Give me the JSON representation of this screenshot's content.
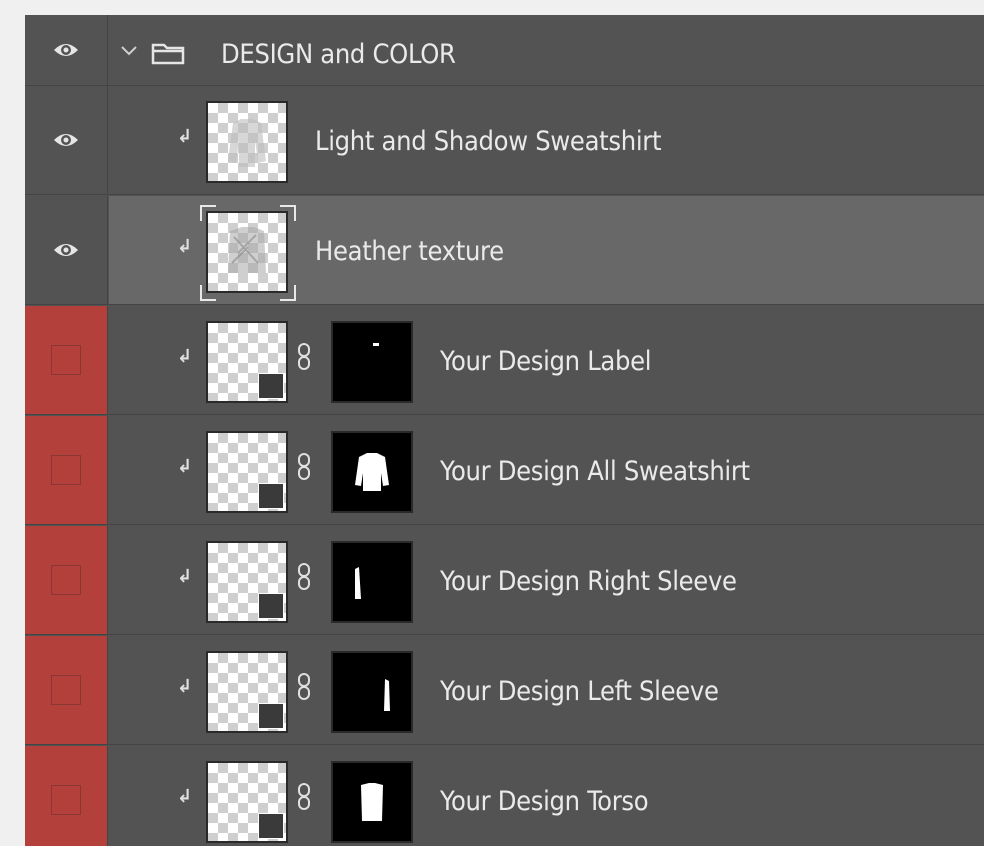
{
  "layers_panel": {
    "group": {
      "name": "DESIGN and COLOR",
      "visible": true,
      "expanded": true
    },
    "layers": [
      {
        "name": "Light and Shadow Sweatshirt",
        "visible": true,
        "clipped": true,
        "has_mask": false,
        "selected": false
      },
      {
        "name": "Heather texture",
        "visible": true,
        "clipped": true,
        "has_mask": false,
        "selected": true
      },
      {
        "name": "Your Design Label",
        "visible": false,
        "clipped": true,
        "has_mask": true,
        "smart_object": true,
        "color_label": "red"
      },
      {
        "name": "Your Design All Sweatshirt",
        "visible": false,
        "clipped": true,
        "has_mask": true,
        "smart_object": true,
        "color_label": "red"
      },
      {
        "name": "Your Design Right Sleeve",
        "visible": false,
        "clipped": true,
        "has_mask": true,
        "smart_object": true,
        "color_label": "red"
      },
      {
        "name": "Your Design Left Sleeve",
        "visible": false,
        "clipped": true,
        "has_mask": true,
        "smart_object": true,
        "color_label": "red"
      },
      {
        "name": "Your Design Torso",
        "visible": false,
        "clipped": true,
        "has_mask": true,
        "smart_object": true,
        "color_label": "red"
      }
    ]
  },
  "icons": {
    "visibility": "eye-icon",
    "collapse": "chevron-down-icon",
    "folder": "folder-icon",
    "clipping": "clipping-mask-icon",
    "link": "chain-link-icon",
    "smart_object": "smart-object-icon"
  },
  "colors": {
    "panel_bg": "#535353",
    "selected_row": "#686868",
    "red_label": "#b3403a",
    "text": "#eaeaea"
  }
}
